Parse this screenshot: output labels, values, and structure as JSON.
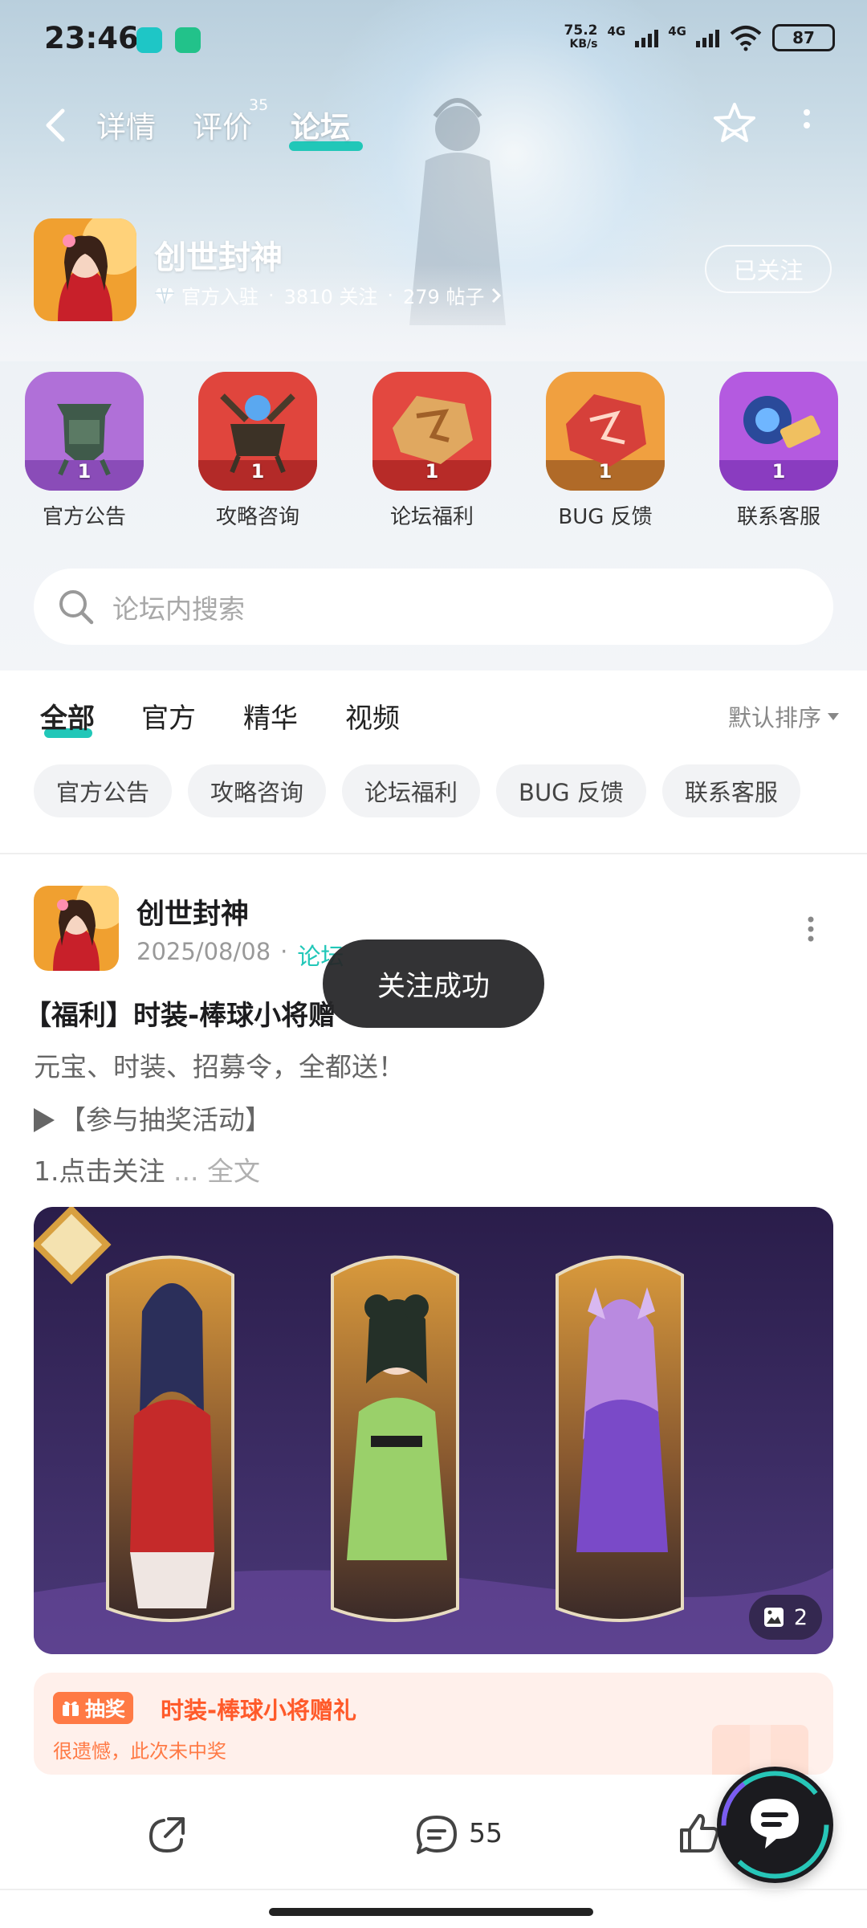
{
  "status_bar": {
    "time": "23:46",
    "net_speed_value": "75.2",
    "net_speed_unit": "KB/s",
    "network_label_1": "4G",
    "network_label_2": "4G",
    "battery": "87"
  },
  "top_nav": {
    "tabs": [
      {
        "label": "详情"
      },
      {
        "label": "评价"
      },
      {
        "label": "论坛"
      }
    ],
    "active_tab": "论坛",
    "review_badge": "35"
  },
  "forum": {
    "name": "创世封神",
    "official_label": "官方入驻",
    "followers": "3810 关注",
    "posts": "279 帖子",
    "follow_button": "已关注"
  },
  "categories": [
    {
      "label": "官方公告",
      "count": "1"
    },
    {
      "label": "攻略咨询",
      "count": "1"
    },
    {
      "label": "论坛福利",
      "count": "1"
    },
    {
      "label": "BUG 反馈",
      "count": "1"
    },
    {
      "label": "联系客服",
      "count": "1"
    }
  ],
  "search": {
    "placeholder": "论坛内搜索"
  },
  "filter_tabs": [
    {
      "label": "全部"
    },
    {
      "label": "官方"
    },
    {
      "label": "精华"
    },
    {
      "label": "视频"
    }
  ],
  "sort_label": "默认排序",
  "chips": [
    {
      "label": "官方公告"
    },
    {
      "label": "攻略咨询"
    },
    {
      "label": "论坛福利"
    },
    {
      "label": "BUG 反馈"
    },
    {
      "label": "联系客服"
    }
  ],
  "post": {
    "author": "创世封神",
    "date": "2025/08/08",
    "dot": "·",
    "tag": "论坛",
    "title": "【福利】时装-棒球小将赠",
    "line1": "元宝、时装、招募令，全都送！",
    "line2": "【参与抽奖活动】",
    "line3": "1.点击关注",
    "line3_more": "... 全文",
    "image_count": "2",
    "lottery": {
      "badge": "抽奖",
      "title": "时装-棒球小将赠礼",
      "subtitle": "很遗憾，此次未中奖"
    },
    "comment_count": "55"
  },
  "toast": "关注成功",
  "colors": {
    "accent": "#21c7b8",
    "lottery_text": "#ff5a2a",
    "lottery_bg": "#fff0eb",
    "toast_bg": "#262628"
  }
}
